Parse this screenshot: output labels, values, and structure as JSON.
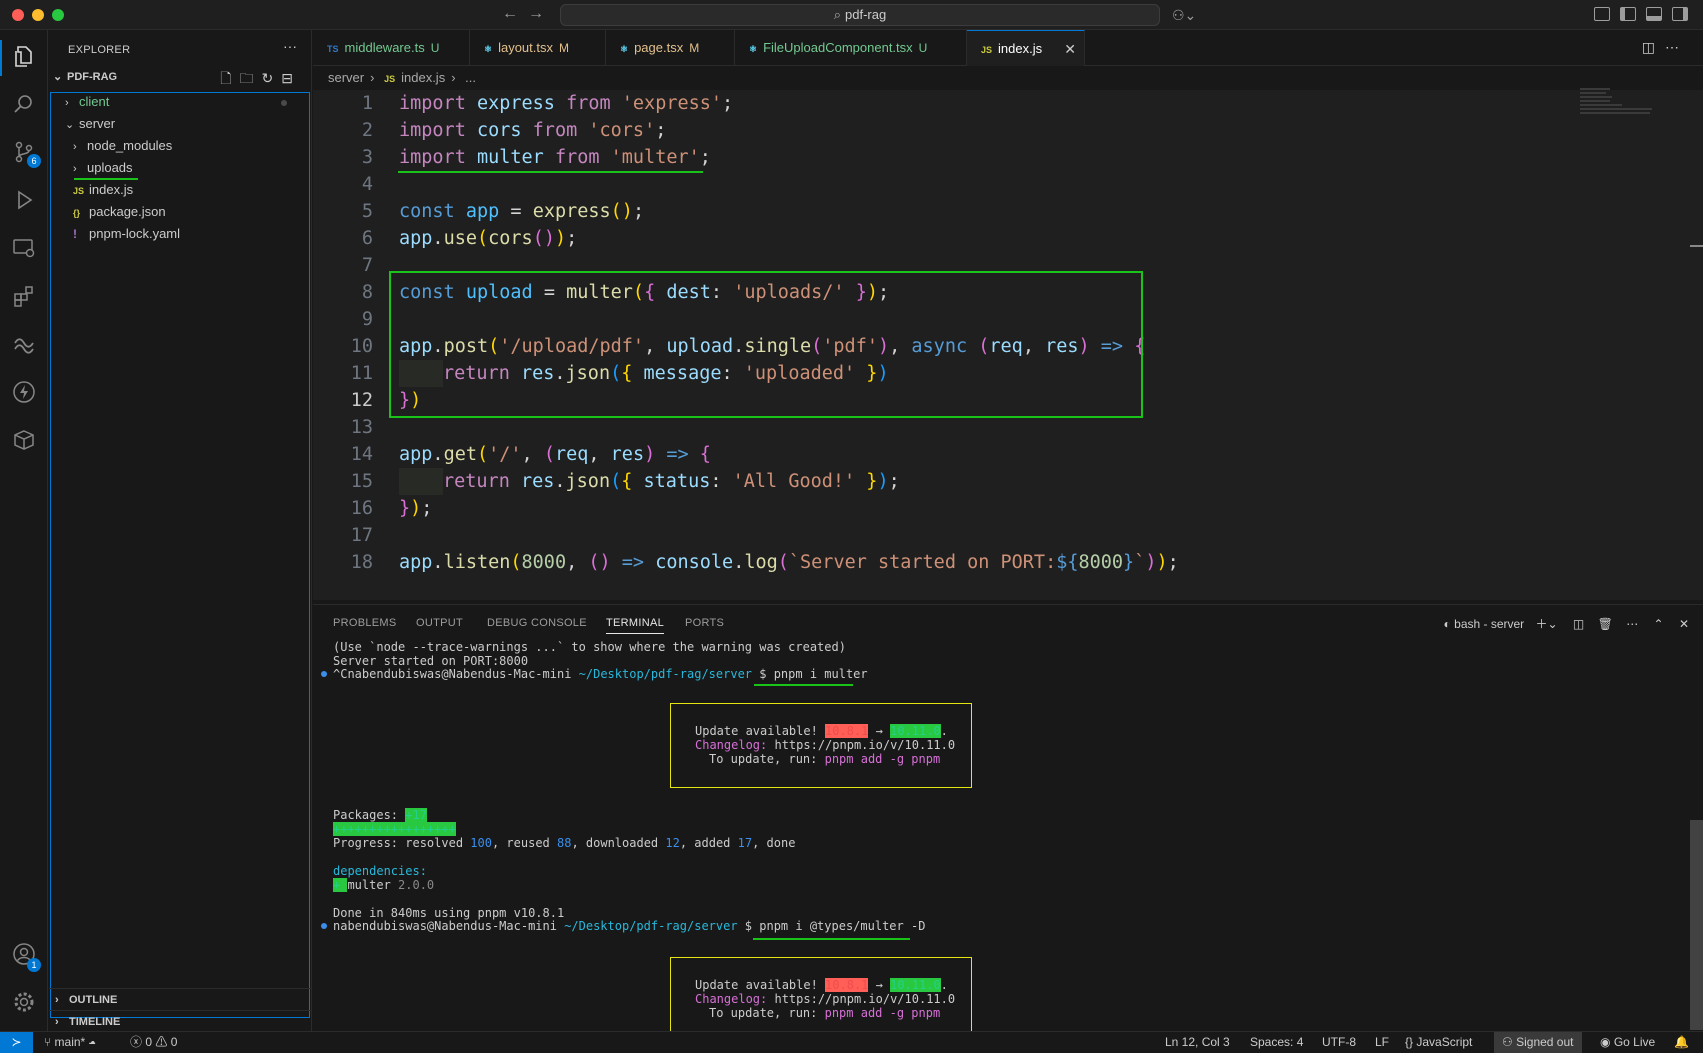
{
  "window": {
    "title": "pdf-rag"
  },
  "activity": {
    "scm_badge": "6",
    "accounts_badge": "1"
  },
  "explorer": {
    "header": "EXPLORER",
    "more": "···",
    "project": "PDF-RAG",
    "tree": [
      {
        "label": "client",
        "color": "#73c991",
        "chev": "›"
      },
      {
        "label": "server",
        "color": "#cccccc",
        "chev": "⌄"
      },
      {
        "label": "node_modules",
        "color": "#cccccc",
        "chev": "›"
      },
      {
        "label": "uploads",
        "color": "#cccccc",
        "chev": "›"
      },
      {
        "label": "index.js",
        "color": "#cccccc",
        "icon": "JS",
        "icon_color": "#cbcb41"
      },
      {
        "label": "package.json",
        "color": "#cccccc",
        "icon": "{}",
        "icon_color": "#cbcb41"
      },
      {
        "label": "pnpm-lock.yaml",
        "color": "#cccccc",
        "icon": "!",
        "icon_color": "#a074c4"
      }
    ],
    "outline": "OUTLINE",
    "timeline": "TIMELINE"
  },
  "tabs": [
    {
      "icon": "TS",
      "label": "middleware.ts",
      "status": "U",
      "color": "#73c991"
    },
    {
      "icon": "⚛",
      "label": "layout.tsx",
      "status": "M",
      "color": "#e2c08d"
    },
    {
      "icon": "⚛",
      "label": "page.tsx",
      "status": "M",
      "color": "#e2c08d"
    },
    {
      "icon": "⚛",
      "label": "FileUploadComponent.tsx",
      "status": "U",
      "color": "#73c991"
    },
    {
      "icon": "JS",
      "label": "index.js",
      "status": "",
      "color": "#ffffff"
    }
  ],
  "breadcrumb": {
    "folder": "server",
    "file_icon": "JS",
    "file": "index.js",
    "tail": "..."
  },
  "editor": {
    "line_numbers": [
      "1",
      "2",
      "3",
      "4",
      "5",
      "6",
      "7",
      "8",
      "9",
      "10",
      "11",
      "12",
      "13",
      "14",
      "15",
      "16",
      "17",
      "18"
    ],
    "current_line": "12"
  },
  "panel": {
    "tabs": [
      "PROBLEMS",
      "OUTPUT",
      "DEBUG CONSOLE",
      "TERMINAL",
      "PORTS"
    ],
    "active_tab": "TERMINAL",
    "shell": "bash - server"
  },
  "terminal": {
    "l1": "(Use `node --trace-warnings ...` to show where the warning was created)",
    "l2": "Server started on PORT:8000",
    "prompt1_user": "^Cnabendubiswas@Nabendus-Mac-mini ",
    "prompt1_path": "~/Desktop/pdf-rag/server",
    "prompt1_cmd": " $ pnpm i multer",
    "upd_prefix": "Update available! ",
    "upd_old": "10.8.1",
    "upd_arrow": " → ",
    "upd_new": "10.11.0",
    "upd_dot": ".",
    "changelog_label": "Changelog:",
    "changelog_url": " https://pnpm.io/v/10.11.0",
    "to_update": "To update, run: ",
    "to_update_cmd": "pnpm add -g pnpm",
    "packages_label": "Packages: ",
    "packages_val": "+17",
    "plus_bar": "+++++++++++++++++",
    "progress_a": "Progress: resolved ",
    "progress_resolved": "100",
    "progress_b": ", reused ",
    "progress_reused": "88",
    "progress_c": ", downloaded ",
    "progress_downloaded": "12",
    "progress_d": ", added ",
    "progress_added": "17",
    "progress_e": ", done",
    "deps_label": "dependencies:",
    "dep_plus": "+ ",
    "dep_name": "multer ",
    "dep_ver": "2.0.0",
    "done": "Done in 840ms using pnpm v10.8.1",
    "prompt2_user": "nabendubiswas@Nabendus-Mac-mini ",
    "prompt2_path": "~/Desktop/pdf-rag/server",
    "prompt2_cmd": " $ pnpm i @types/multer -D"
  },
  "status": {
    "branch": "main*",
    "errors": "0",
    "warnings": "0",
    "position": "Ln 12, Col 3",
    "spaces": "Spaces: 4",
    "encoding": "UTF-8",
    "eol": "LF",
    "language": "JavaScript",
    "signed": "Signed out",
    "golive": "Go Live"
  }
}
